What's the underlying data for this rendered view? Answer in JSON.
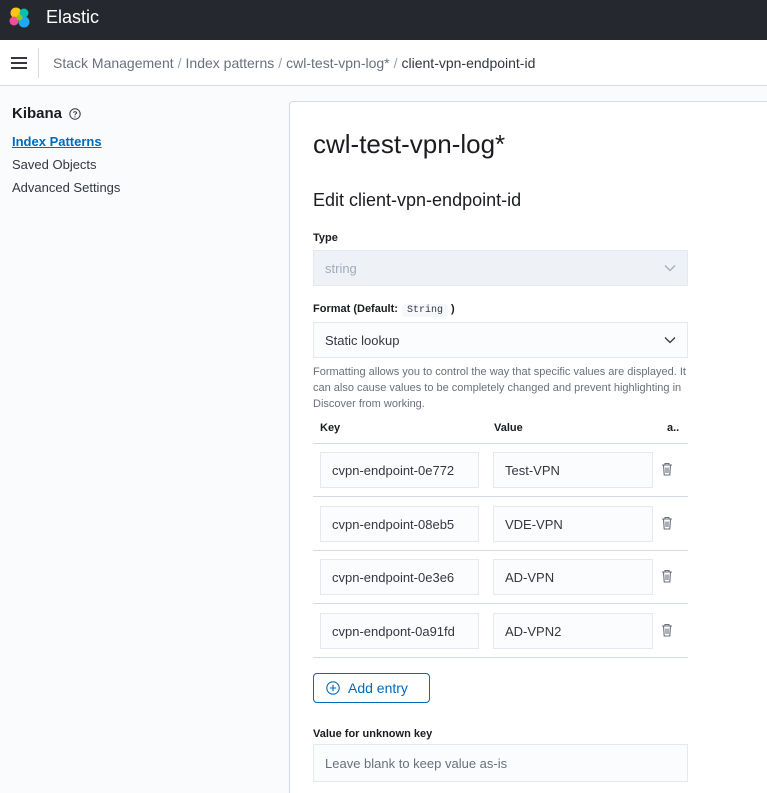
{
  "header": {
    "app_title": "Elastic",
    "logo_icon": "elastic-logo-icon"
  },
  "breadcrumbs": {
    "items": [
      {
        "label": "Stack Management"
      },
      {
        "label": "Index patterns"
      },
      {
        "label": "cwl-test-vpn-log*"
      },
      {
        "label": "client-vpn-endpoint-id"
      }
    ],
    "separator": "/"
  },
  "sidebar": {
    "title": "Kibana",
    "title_icon": "help-icon",
    "items": [
      {
        "label": "Index Patterns",
        "active": true
      },
      {
        "label": "Saved Objects",
        "active": false
      },
      {
        "label": "Advanced Settings",
        "active": false
      }
    ]
  },
  "main": {
    "page_title": "cwl-test-vpn-log*",
    "section_title": "Edit client-vpn-endpoint-id",
    "type_label": "Type",
    "type_value": "string",
    "format_label": "Format (Default:",
    "format_default": "String",
    "format_label_close": ")",
    "format_value": "Static lookup",
    "format_help": "Formatting allows you to control the way that specific values are displayed. It can also cause values to be completely changed and prevent highlighting in Discover from working.",
    "table": {
      "headers": {
        "key": "Key",
        "value": "Value",
        "actions": "a.."
      },
      "rows": [
        {
          "key": "cvpn-endpoint-0e772",
          "value": "Test-VPN"
        },
        {
          "key": "cvpn-endpoint-08eb5",
          "value": "VDE-VPN"
        },
        {
          "key": "cvpn-endpoint-0e3e6",
          "value": "AD-VPN"
        },
        {
          "key": "cvpn-endpont-0a91fd",
          "value": "AD-VPN2"
        }
      ]
    },
    "add_entry_label": "Add entry",
    "unknown_key_label": "Value for unknown key",
    "unknown_key_placeholder": "Leave blank to keep value as-is"
  },
  "colors": {
    "header_bg": "#25282f",
    "link_blue": "#006bb8",
    "border": "#d3dae6"
  }
}
